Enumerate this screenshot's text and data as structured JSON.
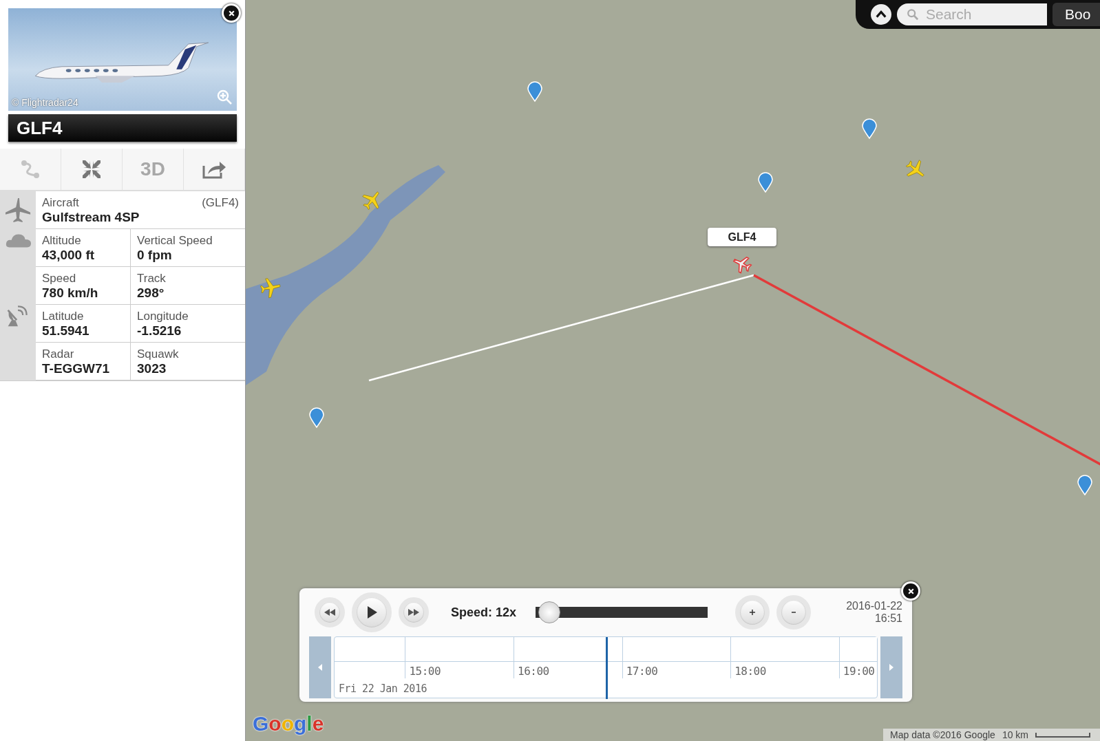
{
  "aircraft_card": {
    "photo_credit": "© Flightradar24",
    "callsign": "GLF4",
    "toolbar": [
      {
        "kind": "route",
        "disabled": true
      },
      {
        "kind": "collapse",
        "disabled": false
      },
      {
        "kind": "view",
        "label": "3D",
        "disabled": true
      },
      {
        "kind": "share",
        "disabled": false
      }
    ],
    "aircraft": {
      "label": "Aircraft",
      "code": "(GLF4)",
      "value": "Gulfstream 4SP"
    },
    "fields": [
      {
        "label": "Altitude",
        "value": "43,000 ft"
      },
      {
        "label": "Vertical Speed",
        "value": "0 fpm"
      },
      {
        "label": "Speed",
        "value": "780 km/h"
      },
      {
        "label": "Track",
        "value": "298°"
      },
      {
        "label": "Latitude",
        "value": "51.5941"
      },
      {
        "label": "Longitude",
        "value": "-1.5216"
      },
      {
        "label": "Radar",
        "value": "T-EGGW71"
      },
      {
        "label": "Squawk",
        "value": "3023"
      }
    ]
  },
  "map": {
    "search": {
      "placeholder": "Search"
    },
    "top_button": "Boo",
    "flight_label": "GLF4",
    "logo": "Google",
    "attribution": "Map data ©2016 Google",
    "scale": "10 km"
  },
  "playback": {
    "playing": false,
    "speed_label": "Speed: 12x",
    "speed": {
      "level": 0.02
    },
    "date": "2016-01-22",
    "time": "16:51",
    "ticks": [
      "15:00",
      "16:00",
      "17:00",
      "18:00",
      "19:00"
    ],
    "day_label": "Fri 22 Jan 2016",
    "cursor": {
      "level": 0.5
    }
  }
}
